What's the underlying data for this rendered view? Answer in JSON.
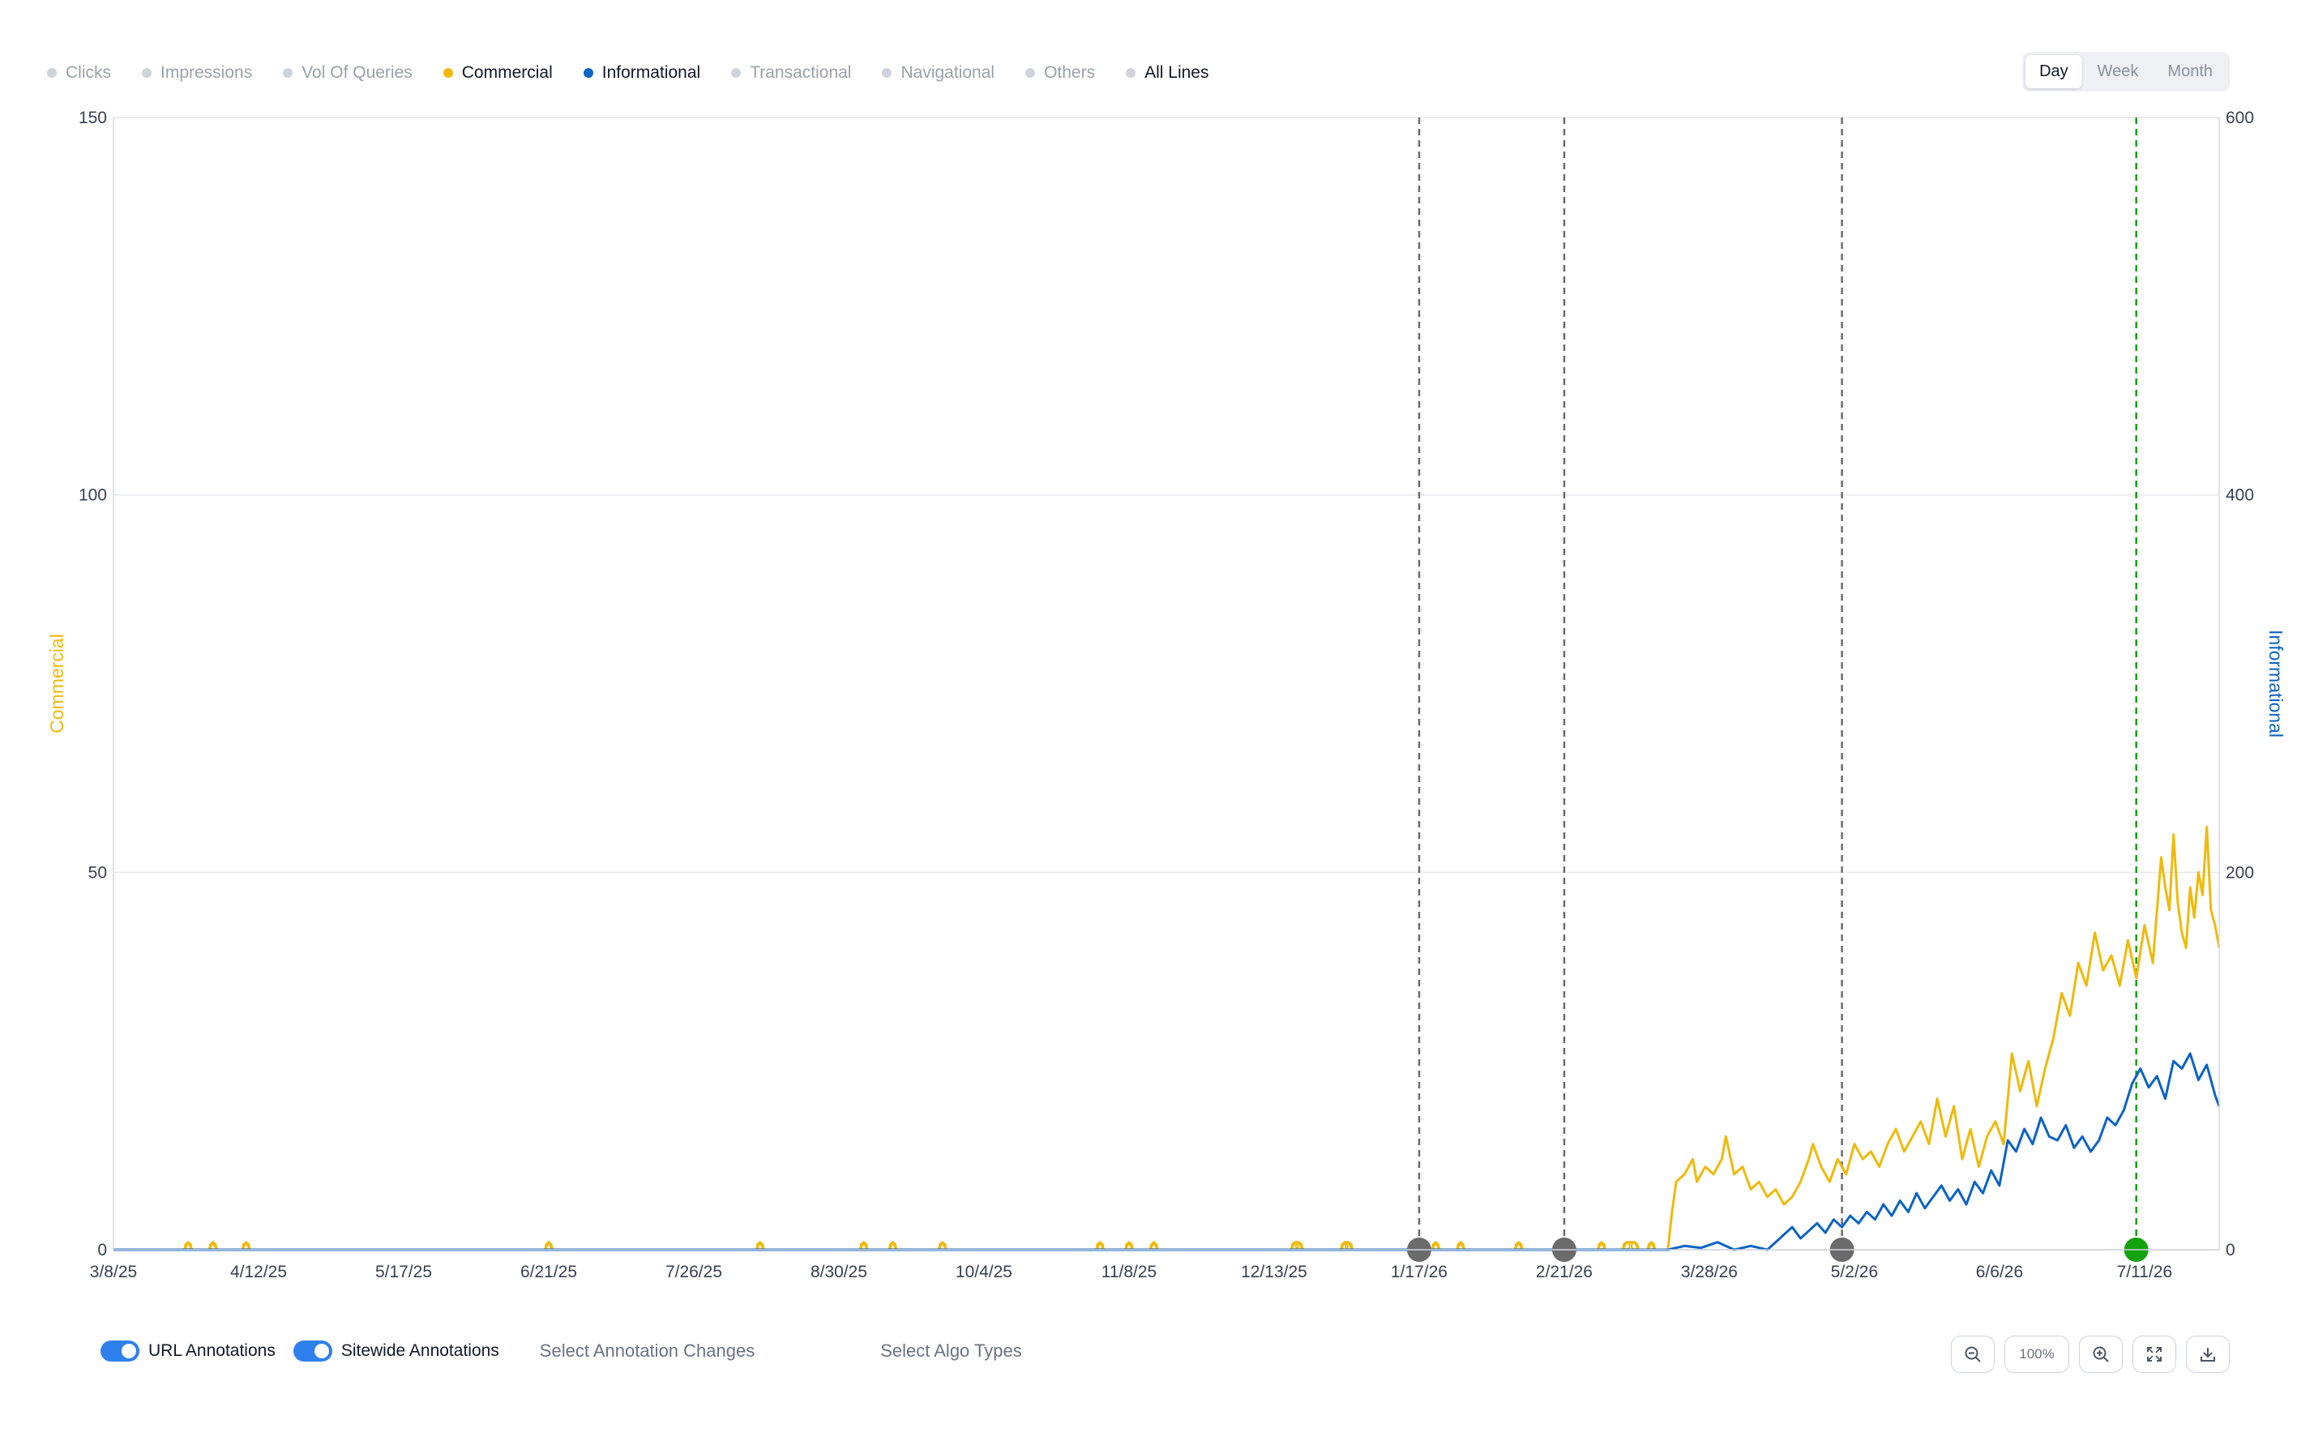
{
  "legend": {
    "items": [
      {
        "label": "Clicks",
        "active": false,
        "color": "#cfd3da"
      },
      {
        "label": "Impressions",
        "active": false,
        "color": "#cfd3da"
      },
      {
        "label": "Vol Of Queries",
        "active": false,
        "color": "#cfd3da"
      },
      {
        "label": "Commercial",
        "active": true,
        "color": "#f0b90b"
      },
      {
        "label": "Informational",
        "active": true,
        "color": "#0b63c5"
      },
      {
        "label": "Transactional",
        "active": false,
        "color": "#cfd3da"
      },
      {
        "label": "Navigational",
        "active": false,
        "color": "#cfd3da"
      },
      {
        "label": "Others",
        "active": false,
        "color": "#cfd3da"
      },
      {
        "label": "All Lines",
        "active": true,
        "color": "#cfd3da"
      }
    ]
  },
  "period": {
    "day": "Day",
    "week": "Week",
    "month": "Month",
    "selected": "Day"
  },
  "controls": {
    "url_annotations": "URL Annotations",
    "sitewide_annotations": "Sitewide Annotations",
    "select_annotation_changes": "Select Annotation Changes",
    "select_algo_types": "Select Algo Types",
    "zoom_level": "100%"
  },
  "icons": [
    "zoom-out-icon",
    "zoom-in-icon",
    "fullscreen-icon",
    "download-icon"
  ],
  "chart_data": {
    "type": "line",
    "x_start": "3/8/25",
    "x_end": "7/29/26",
    "x_ticks": [
      "3/8/25",
      "4/12/25",
      "5/17/25",
      "6/21/25",
      "7/26/25",
      "8/30/25",
      "10/4/25",
      "11/8/25",
      "12/13/25",
      "1/17/26",
      "2/21/26",
      "3/28/26",
      "5/2/26",
      "6/6/26",
      "7/11/26"
    ],
    "y_left": {
      "label": "Commercial",
      "ticks": [
        "0",
        "50",
        "100",
        "150"
      ],
      "range": [
        0,
        150
      ],
      "color": "#f0b90b"
    },
    "y_right": {
      "label": "Informational",
      "ticks": [
        "0",
        "200",
        "400",
        "600"
      ],
      "range": [
        0,
        600
      ],
      "color": "#0b63c5"
    },
    "grid": true,
    "annotations": [
      {
        "date": "1/17/26",
        "color": "#6b6b6b"
      },
      {
        "date": "2/21/26",
        "color": "#6b6b6b"
      },
      {
        "date": "4/29/26",
        "color": "#6b6b6b"
      },
      {
        "date": "7/9/26",
        "color": "#13a10e"
      }
    ],
    "series": [
      {
        "name": "Commercial",
        "axis": "left",
        "color": "#f0b90b",
        "points": [
          [
            "3/8/25",
            0
          ],
          [
            "3/25/25",
            0
          ],
          [
            "3/26/25",
            1
          ],
          [
            "3/27/25",
            0
          ],
          [
            "3/31/25",
            0
          ],
          [
            "4/1/25",
            1
          ],
          [
            "4/2/25",
            0
          ],
          [
            "4/8/25",
            0
          ],
          [
            "4/9/25",
            1
          ],
          [
            "4/10/25",
            0
          ],
          [
            "6/20/25",
            0
          ],
          [
            "6/21/25",
            1
          ],
          [
            "6/22/25",
            0
          ],
          [
            "8/10/25",
            0
          ],
          [
            "8/11/25",
            1
          ],
          [
            "8/12/25",
            0
          ],
          [
            "9/4/25",
            0
          ],
          [
            "9/5/25",
            1
          ],
          [
            "9/6/25",
            0
          ],
          [
            "9/11/25",
            0
          ],
          [
            "9/12/25",
            1
          ],
          [
            "9/13/25",
            0
          ],
          [
            "9/23/25",
            0
          ],
          [
            "9/24/25",
            1
          ],
          [
            "9/25/25",
            0
          ],
          [
            "10/31/25",
            0
          ],
          [
            "11/1/25",
            1
          ],
          [
            "11/2/25",
            0
          ],
          [
            "11/7/25",
            0
          ],
          [
            "11/8/25",
            1
          ],
          [
            "11/9/25",
            0
          ],
          [
            "11/13/25",
            0
          ],
          [
            "11/14/25",
            1
          ],
          [
            "11/15/25",
            0
          ],
          [
            "12/17/25",
            0
          ],
          [
            "12/18/25",
            1
          ],
          [
            "12/19/25",
            1
          ],
          [
            "12/20/25",
            0
          ],
          [
            "12/29/25",
            0
          ],
          [
            "12/30/25",
            1
          ],
          [
            "12/31/25",
            1
          ],
          [
            "1/1/26",
            0
          ],
          [
            "1/20/26",
            0
          ],
          [
            "1/21/26",
            1
          ],
          [
            "1/22/26",
            0
          ],
          [
            "1/26/26",
            0
          ],
          [
            "1/27/26",
            1
          ],
          [
            "1/28/26",
            0
          ],
          [
            "2/9/26",
            0
          ],
          [
            "2/10/26",
            1
          ],
          [
            "2/11/26",
            0
          ],
          [
            "3/1/26",
            0
          ],
          [
            "3/2/26",
            1
          ],
          [
            "3/3/26",
            0
          ],
          [
            "3/7/26",
            0
          ],
          [
            "3/8/26",
            1
          ],
          [
            "3/10/26",
            1
          ],
          [
            "3/11/26",
            0
          ],
          [
            "3/13/26",
            0
          ],
          [
            "3/14/26",
            1
          ],
          [
            "3/15/26",
            0
          ],
          [
            "3/18/26",
            0
          ],
          [
            "3/19/26",
            5
          ],
          [
            "3/20/26",
            9
          ],
          [
            "3/22/26",
            10
          ],
          [
            "3/24/26",
            12
          ],
          [
            "3/25/26",
            9
          ],
          [
            "3/27/26",
            11
          ],
          [
            "3/29/26",
            10
          ],
          [
            "3/31/26",
            12
          ],
          [
            "4/1/26",
            15
          ],
          [
            "4/3/26",
            10
          ],
          [
            "4/5/26",
            11
          ],
          [
            "4/7/26",
            8
          ],
          [
            "4/9/26",
            9
          ],
          [
            "4/11/26",
            7
          ],
          [
            "4/13/26",
            8
          ],
          [
            "4/15/26",
            6
          ],
          [
            "4/17/26",
            7
          ],
          [
            "4/19/26",
            9
          ],
          [
            "4/21/26",
            12
          ],
          [
            "4/22/26",
            14
          ],
          [
            "4/24/26",
            11
          ],
          [
            "4/26/26",
            9
          ],
          [
            "4/28/26",
            12
          ],
          [
            "4/30/26",
            10
          ],
          [
            "5/2/26",
            14
          ],
          [
            "5/4/26",
            12
          ],
          [
            "5/6/26",
            13
          ],
          [
            "5/8/26",
            11
          ],
          [
            "5/10/26",
            14
          ],
          [
            "5/12/26",
            16
          ],
          [
            "5/14/26",
            13
          ],
          [
            "5/16/26",
            15
          ],
          [
            "5/18/26",
            17
          ],
          [
            "5/20/26",
            14
          ],
          [
            "5/22/26",
            20
          ],
          [
            "5/24/26",
            15
          ],
          [
            "5/26/26",
            19
          ],
          [
            "5/28/26",
            12
          ],
          [
            "5/30/26",
            16
          ],
          [
            "6/1/26",
            11
          ],
          [
            "6/3/26",
            15
          ],
          [
            "6/5/26",
            17
          ],
          [
            "6/7/26",
            14
          ],
          [
            "6/9/26",
            26
          ],
          [
            "6/11/26",
            21
          ],
          [
            "6/13/26",
            25
          ],
          [
            "6/15/26",
            19
          ],
          [
            "6/17/26",
            24
          ],
          [
            "6/19/26",
            28
          ],
          [
            "6/21/26",
            34
          ],
          [
            "6/23/26",
            31
          ],
          [
            "6/25/26",
            38
          ],
          [
            "6/27/26",
            35
          ],
          [
            "6/29/26",
            42
          ],
          [
            "7/1/26",
            37
          ],
          [
            "7/3/26",
            39
          ],
          [
            "7/5/26",
            35
          ],
          [
            "7/7/26",
            41
          ],
          [
            "7/9/26",
            36
          ],
          [
            "7/11/26",
            43
          ],
          [
            "7/13/26",
            38
          ],
          [
            "7/15/26",
            52
          ],
          [
            "7/16/26",
            48
          ],
          [
            "7/17/26",
            45
          ],
          [
            "7/18/26",
            55
          ],
          [
            "7/19/26",
            46
          ],
          [
            "7/20/26",
            42
          ],
          [
            "7/21/26",
            40
          ],
          [
            "7/22/26",
            48
          ],
          [
            "7/23/26",
            44
          ],
          [
            "7/24/26",
            50
          ],
          [
            "7/25/26",
            47
          ],
          [
            "7/26/26",
            56
          ],
          [
            "7/27/26",
            45
          ],
          [
            "7/28/26",
            43
          ],
          [
            "7/29/26",
            40
          ]
        ]
      },
      {
        "name": "Informational",
        "axis": "right",
        "color": "#0b63c5",
        "points": [
          [
            "3/8/25",
            0
          ],
          [
            "3/18/26",
            0
          ],
          [
            "3/22/26",
            2
          ],
          [
            "3/26/26",
            1
          ],
          [
            "3/30/26",
            4
          ],
          [
            "4/3/26",
            0
          ],
          [
            "4/7/26",
            2
          ],
          [
            "4/11/26",
            0
          ],
          [
            "4/15/26",
            8
          ],
          [
            "4/17/26",
            12
          ],
          [
            "4/19/26",
            6
          ],
          [
            "4/21/26",
            10
          ],
          [
            "4/23/26",
            14
          ],
          [
            "4/25/26",
            9
          ],
          [
            "4/27/26",
            16
          ],
          [
            "4/29/26",
            12
          ],
          [
            "5/1/26",
            18
          ],
          [
            "5/3/26",
            14
          ],
          [
            "5/5/26",
            20
          ],
          [
            "5/7/26",
            16
          ],
          [
            "5/9/26",
            24
          ],
          [
            "5/11/26",
            18
          ],
          [
            "5/13/26",
            26
          ],
          [
            "5/15/26",
            20
          ],
          [
            "5/17/26",
            30
          ],
          [
            "5/19/26",
            22
          ],
          [
            "5/21/26",
            28
          ],
          [
            "5/23/26",
            34
          ],
          [
            "5/25/26",
            26
          ],
          [
            "5/27/26",
            32
          ],
          [
            "5/29/26",
            24
          ],
          [
            "5/31/26",
            36
          ],
          [
            "6/2/26",
            30
          ],
          [
            "6/4/26",
            42
          ],
          [
            "6/6/26",
            34
          ],
          [
            "6/8/26",
            58
          ],
          [
            "6/10/26",
            52
          ],
          [
            "6/12/26",
            64
          ],
          [
            "6/14/26",
            56
          ],
          [
            "6/16/26",
            70
          ],
          [
            "6/18/26",
            60
          ],
          [
            "6/20/26",
            58
          ],
          [
            "6/22/26",
            66
          ],
          [
            "6/24/26",
            54
          ],
          [
            "6/26/26",
            60
          ],
          [
            "6/28/26",
            52
          ],
          [
            "6/30/26",
            58
          ],
          [
            "7/2/26",
            70
          ],
          [
            "7/4/26",
            66
          ],
          [
            "7/6/26",
            74
          ],
          [
            "7/8/26",
            88
          ],
          [
            "7/10/26",
            96
          ],
          [
            "7/12/26",
            86
          ],
          [
            "7/14/26",
            92
          ],
          [
            "7/16/26",
            80
          ],
          [
            "7/18/26",
            100
          ],
          [
            "7/20/26",
            96
          ],
          [
            "7/22/26",
            104
          ],
          [
            "7/24/26",
            90
          ],
          [
            "7/26/26",
            98
          ],
          [
            "7/28/26",
            82
          ],
          [
            "7/29/26",
            76
          ]
        ]
      }
    ]
  }
}
